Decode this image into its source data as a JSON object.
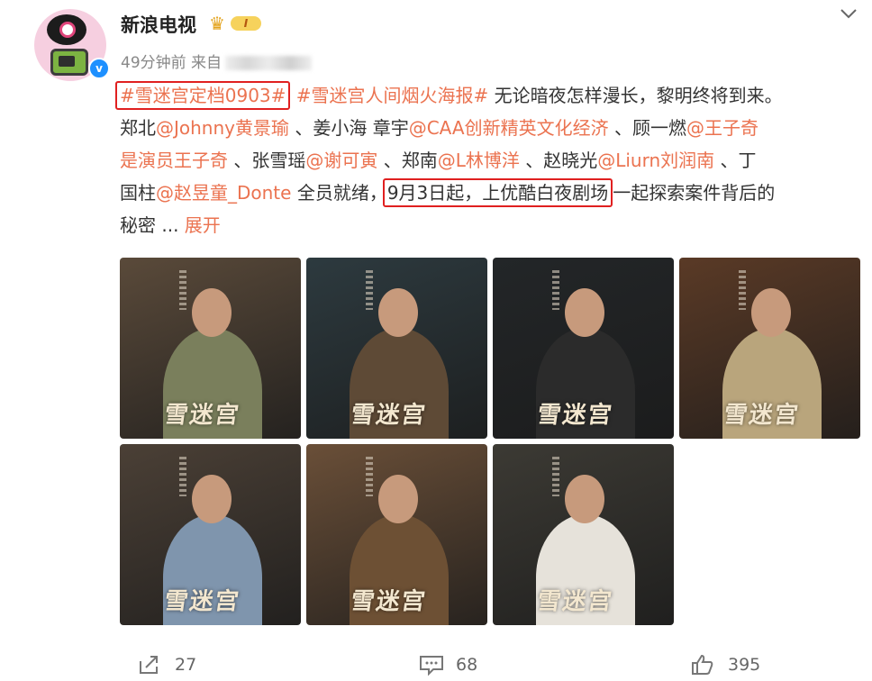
{
  "user": {
    "name": "新浪电视",
    "member_level": "I",
    "verified_mark": "v"
  },
  "meta": {
    "time": "49分钟前",
    "from_label": "来自"
  },
  "post": {
    "lines": [
      [
        {
          "t": "#雪迷宫定档0903#",
          "k": "tag-boxed"
        },
        {
          "t": " ",
          "k": "text"
        },
        {
          "t": "#雪迷宫人间烟火海报#",
          "k": "tag"
        },
        {
          "t": " 无论暗夜怎样漫长，黎明终将到来。",
          "k": "text"
        }
      ],
      [
        {
          "t": "郑北",
          "k": "text"
        },
        {
          "t": "@Johnny黄景瑜",
          "k": "mention"
        },
        {
          "t": " 、姜小海 章宇",
          "k": "text"
        },
        {
          "t": "@CAA创新精英文化经济",
          "k": "mention"
        },
        {
          "t": " 、顾一燃",
          "k": "text"
        },
        {
          "t": "@王子奇",
          "k": "mention"
        }
      ],
      [
        {
          "t": "是演员王子奇",
          "k": "mention"
        },
        {
          "t": " 、张雪瑶",
          "k": "text"
        },
        {
          "t": "@谢可寅",
          "k": "mention"
        },
        {
          "t": " 、郑南",
          "k": "text"
        },
        {
          "t": "@L林博洋",
          "k": "mention"
        },
        {
          "t": " 、赵晓光",
          "k": "text"
        },
        {
          "t": "@Liurn刘润南",
          "k": "mention"
        },
        {
          "t": " 、丁",
          "k": "text"
        }
      ],
      [
        {
          "t": "国柱",
          "k": "text"
        },
        {
          "t": "@赵昱童_Donte",
          "k": "mention"
        },
        {
          "t": " 全员就绪，",
          "k": "text"
        },
        {
          "t": "9月3日起，上优酷白夜剧场",
          "k": "boxed"
        },
        {
          "t": "一起探索案件背后的",
          "k": "text"
        }
      ],
      [
        {
          "t": "秘密  ... ",
          "k": "text"
        },
        {
          "t": "展开",
          "k": "expand"
        }
      ]
    ]
  },
  "images": [
    {
      "id": "poster-1",
      "bg": "#5a4a3a",
      "fig": "#7a7f5c",
      "logo": "雪迷宫"
    },
    {
      "id": "poster-2",
      "bg": "#2d3a3f",
      "fig": "#5e4a36",
      "logo": "雪迷宫"
    },
    {
      "id": "poster-3",
      "bg": "#232628",
      "fig": "#2b2b2b",
      "logo": "雪迷宫"
    },
    {
      "id": "poster-4",
      "bg": "#5a3a26",
      "fig": "#b9a57c",
      "logo": "雪迷宫"
    },
    {
      "id": "poster-5",
      "bg": "#4b4036",
      "fig": "#7f95ad",
      "logo": "雪迷宫"
    },
    {
      "id": "poster-6",
      "bg": "#6a4f38",
      "fig": "#6d5034",
      "logo": "雪迷宫"
    },
    {
      "id": "poster-7",
      "bg": "#3c3a34",
      "fig": "#e6e2da",
      "logo": "雪迷宫"
    }
  ],
  "actions": {
    "share": "27",
    "comment": "68",
    "like": "395"
  },
  "colors": {
    "link": "#eb7350",
    "highlight_box": "#e02020",
    "verified": "#1e90ff"
  }
}
